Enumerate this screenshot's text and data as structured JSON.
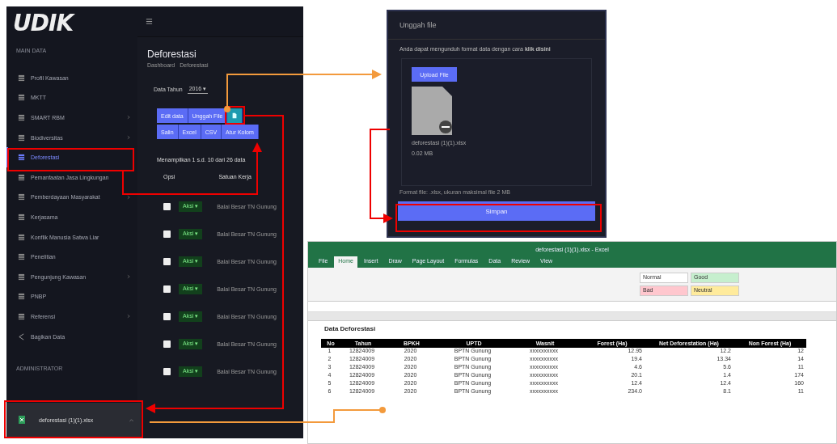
{
  "app": {
    "logo": "UDIK",
    "sidebar": {
      "section": "MAIN DATA",
      "items": [
        {
          "label": "Profil Kawasan",
          "kind": "grid",
          "expandable": false,
          "selected": false
        },
        {
          "label": "MKTT",
          "kind": "grid",
          "expandable": false,
          "selected": false
        },
        {
          "label": "SMART RBM",
          "kind": "grid",
          "expandable": true,
          "selected": false
        },
        {
          "label": "Biodiversitas",
          "kind": "grid",
          "expandable": true,
          "selected": false
        },
        {
          "label": "Deforestasi",
          "kind": "grid",
          "expandable": false,
          "selected": true
        },
        {
          "label": "Pemanfaatan Jasa Lingkungan",
          "kind": "grid",
          "expandable": false,
          "selected": false
        },
        {
          "label": "Pemberdayaan Masyarakat",
          "kind": "grid",
          "expandable": true,
          "selected": false
        },
        {
          "label": "Kerjasama",
          "kind": "grid",
          "expandable": false,
          "selected": false
        },
        {
          "label": "Konflik Manusia Satwa Liar",
          "kind": "grid",
          "expandable": false,
          "selected": false
        },
        {
          "label": "Penelitian",
          "kind": "grid",
          "expandable": false,
          "selected": false
        },
        {
          "label": "Pengunjung Kawasan",
          "kind": "grid",
          "expandable": true,
          "selected": false
        },
        {
          "label": "PNBP",
          "kind": "grid",
          "expandable": false,
          "selected": false
        },
        {
          "label": "Referensi",
          "kind": "grid",
          "expandable": true,
          "selected": false
        },
        {
          "label": "Bagikan Data",
          "kind": "share",
          "expandable": false,
          "selected": false
        }
      ],
      "admin_section": "ADMINISTRATOR"
    },
    "title": "Deforestasi",
    "breadcrumb": [
      "Dashboard",
      "Deforestasi"
    ],
    "year_filter": {
      "label": "Data Tahun",
      "value": "2016 ▾"
    },
    "buttons_top": [
      "Edit data",
      "Unggah File"
    ],
    "buttons_bottom": [
      "Salin",
      "Excel",
      "CSV",
      "Atur Kolom"
    ],
    "summary": "Menampilkan 1 s.d. 10 dari 26 data",
    "columns": [
      "Opsi",
      "Satuan Kerja"
    ],
    "rows": [
      {
        "checked": false,
        "action": "Aksi ▾",
        "unit": "Balai Besar TN Gunung"
      },
      {
        "checked": false,
        "action": "Aksi ▾",
        "unit": "Balai Besar TN Gunung"
      },
      {
        "checked": false,
        "action": "Aksi ▾",
        "unit": "Balai Besar TN Gunung"
      },
      {
        "checked": false,
        "action": "Aksi ▾",
        "unit": "Balai Besar TN Gunung"
      },
      {
        "checked": false,
        "action": "Aksi ▾",
        "unit": "Balai Besar TN Gunung"
      },
      {
        "checked": false,
        "action": "Aksi ▾",
        "unit": "Balai Besar TN Gunung"
      },
      {
        "checked": false,
        "action": "Aksi ▾",
        "unit": "Balai Besar TN Gunung"
      }
    ],
    "download": {
      "filename": "deforestasi (1)(1).xlsx"
    }
  },
  "upload_dialog": {
    "title": "Unggah file",
    "hint": "Anda dapat mengunduh format data dengan cara **klik disini**",
    "upload_button": "Upload File",
    "file_name": "deforestasi (1)(1).xlsx",
    "file_size": "0.02 MB",
    "footer": "Format file: .xlsx, ukuran maksimal file 2 MB",
    "save_button": "Simpan"
  },
  "excel": {
    "title": "deforestasi (1)(1).xlsx - Excel",
    "tabs": [
      {
        "label": "File",
        "selected": false
      },
      {
        "label": "Home",
        "selected": true
      },
      {
        "label": "Insert",
        "selected": false
      },
      {
        "label": "Draw",
        "selected": false
      },
      {
        "label": "Page Layout",
        "selected": false
      },
      {
        "label": "Formulas",
        "selected": false
      },
      {
        "label": "Data",
        "selected": false
      },
      {
        "label": "Review",
        "selected": false
      },
      {
        "label": "View",
        "selected": false
      }
    ],
    "styles": [
      {
        "label": "Normal",
        "color": "#ffffff"
      },
      {
        "label": "Bad",
        "color": "#ffc7ce"
      },
      {
        "label": "Good",
        "color": "#c6efce"
      },
      {
        "label": "Neutral",
        "color": "#ffeb9c"
      }
    ],
    "sheet_title": "Data Deforestasi",
    "columns": [
      "No",
      "Tahun",
      "BPKH",
      "UPTD",
      "Wasnit",
      "Forest (Ha)",
      "Net Deforestation (Ha)",
      "Non Forest (Ha)"
    ],
    "rows": [
      [
        "1",
        "12824009",
        "2020",
        "BPTN Gunung",
        "xxxxxxxxxx",
        "12.95",
        "12.2",
        "12"
      ],
      [
        "2",
        "12824009",
        "2020",
        "BPTN Gunung",
        "xxxxxxxxxx",
        "19.4",
        "13.34",
        "14"
      ],
      [
        "3",
        "12824009",
        "2020",
        "BPTN Gunung",
        "xxxxxxxxxx",
        "4.6",
        "5.6",
        "11"
      ],
      [
        "4",
        "12824009",
        "2020",
        "BPTN Gunung",
        "xxxxxxxxxx",
        "20.1",
        "1.4",
        "174"
      ],
      [
        "5",
        "12824009",
        "2020",
        "BPTN Gunung",
        "xxxxxxxxxx",
        "12.4",
        "12.4",
        "160"
      ],
      [
        "6",
        "12824009",
        "2020",
        "BPTN Gunung",
        "xxxxxxxxxx",
        "234.0",
        "8.1",
        "11"
      ]
    ]
  }
}
